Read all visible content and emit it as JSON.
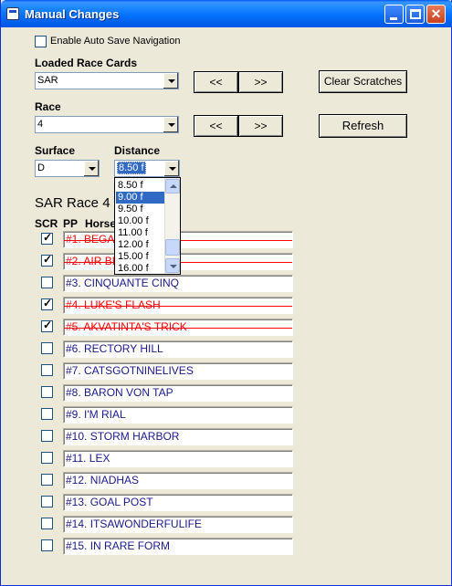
{
  "window": {
    "title": "Manual Changes"
  },
  "auto_save": {
    "label": "Enable Auto Save Navigation",
    "checked": false
  },
  "race_cards": {
    "label": "Loaded Race Cards",
    "value": "SAR"
  },
  "race": {
    "label": "Race",
    "value": "4"
  },
  "nav_buttons": {
    "prev": "<<",
    "next": ">>"
  },
  "actions": {
    "clear_scratches": "Clear Scratches",
    "refresh": "Refresh"
  },
  "surface": {
    "label": "Surface",
    "value": "D"
  },
  "distance": {
    "label": "Distance",
    "value": "8.50 f",
    "options": [
      "8.50 f",
      "9.00 f",
      "9.50 f",
      "10.00 f",
      "11.00 f",
      "12.00 f",
      "15.00 f",
      "16.00 f"
    ],
    "highlighted": "9.00 f"
  },
  "section_title": "SAR Race 4",
  "headers": {
    "scr": "SCR",
    "pp": "PP",
    "horse": "Horse"
  },
  "horses": [
    {
      "text": "#1.  BEGA",
      "scratched": true
    },
    {
      "text": "#2.  AIR BR",
      "scratched": true
    },
    {
      "text": "#3.  CINQUANTE CINQ",
      "scratched": false
    },
    {
      "text": "#4.  LUKE'S FLASH",
      "scratched": true
    },
    {
      "text": "#5.  AKVATINTA'S TRICK",
      "scratched": true
    },
    {
      "text": "#6.  RECTORY HILL",
      "scratched": false
    },
    {
      "text": "#7.  CATSGOTNINELIVES",
      "scratched": false
    },
    {
      "text": "#8.  BARON VON TAP",
      "scratched": false
    },
    {
      "text": "#9.  I'M RIAL",
      "scratched": false
    },
    {
      "text": "#10.  STORM HARBOR",
      "scratched": false
    },
    {
      "text": "#11.  LEX",
      "scratched": false
    },
    {
      "text": "#12.  NIADHAS",
      "scratched": false
    },
    {
      "text": "#13.  GOAL POST",
      "scratched": false
    },
    {
      "text": "#14.  ITSAWONDERFULIFE",
      "scratched": false
    },
    {
      "text": "#15.  IN RARE FORM",
      "scratched": false
    }
  ],
  "colors": {
    "scratched_text": "#ff0000",
    "horse_text": "#1a1a8c",
    "selection": "#316ac5"
  },
  "icons": {
    "title": "app-window-icon",
    "minimize": "minimize-icon",
    "maximize": "maximize-icon",
    "close": "close-icon"
  }
}
